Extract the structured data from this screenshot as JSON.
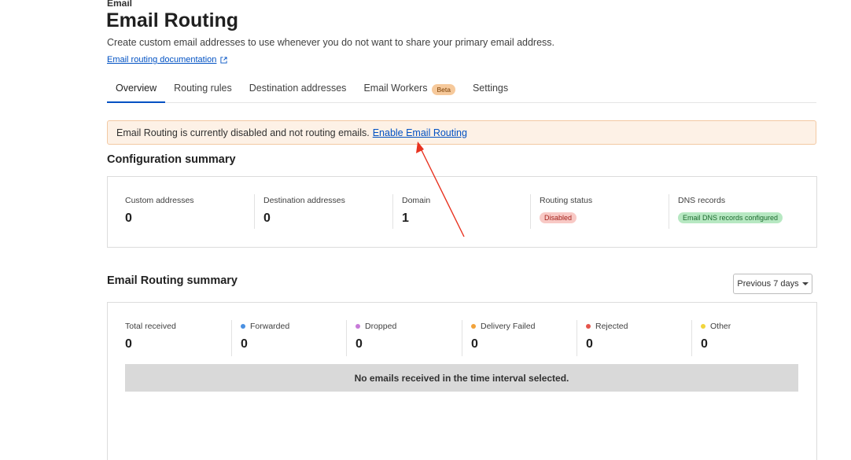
{
  "header": {
    "eyebrow": "Email",
    "title": "Email Routing",
    "subtitle": "Create custom email addresses to use whenever you do not want to share your primary email address.",
    "doc_link": "Email routing documentation"
  },
  "tabs": [
    {
      "label": "Overview",
      "active": true
    },
    {
      "label": "Routing rules"
    },
    {
      "label": "Destination addresses"
    },
    {
      "label": "Email Workers",
      "badge": "Beta"
    },
    {
      "label": "Settings"
    }
  ],
  "banner": {
    "text": "Email Routing is currently disabled and not routing emails.",
    "link": "Enable Email Routing"
  },
  "config": {
    "heading": "Configuration summary",
    "stats": [
      {
        "label": "Custom addresses",
        "value": "0"
      },
      {
        "label": "Destination addresses",
        "value": "0"
      },
      {
        "label": "Domain",
        "value": "1"
      },
      {
        "label": "Routing status",
        "badge": "Disabled"
      },
      {
        "label": "DNS records",
        "badge": "Email DNS records configured"
      }
    ]
  },
  "summary": {
    "heading": "Email Routing summary",
    "range": "Previous 7 days",
    "stats": [
      {
        "label": "Total received",
        "value": "0"
      },
      {
        "label": "Forwarded",
        "value": "0",
        "color": "#4a90e2"
      },
      {
        "label": "Dropped",
        "value": "0",
        "color": "#c77ad8"
      },
      {
        "label": "Delivery Failed",
        "value": "0",
        "color": "#f2a33a"
      },
      {
        "label": "Rejected",
        "value": "0",
        "color": "#e5544b"
      },
      {
        "label": "Other",
        "value": "0",
        "color": "#f1d53c"
      }
    ],
    "empty_message": "No emails received in the time interval selected."
  },
  "colors": {
    "link": "#0051c3",
    "disabled_bg": "#f8c9c5",
    "disabled_text": "#a3211b",
    "dns_bg": "#b7e8c2",
    "dns_text": "#1c6b2f",
    "annotation_arrow": "#e8321f"
  }
}
